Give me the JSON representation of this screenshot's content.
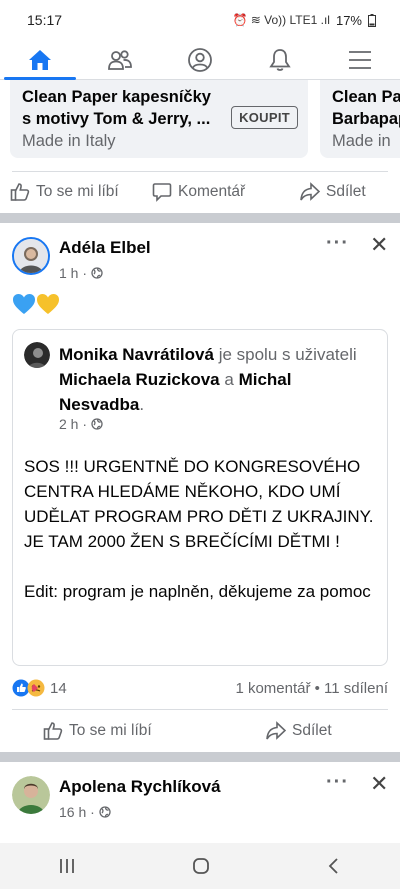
{
  "status_bar": {
    "time": "15:17",
    "icons": "⏰ ≋ Vo)) LTE1 .ıl",
    "battery": "17%"
  },
  "nav": {
    "items": [
      {
        "name": "home",
        "icon": "home-icon",
        "active": true
      },
      {
        "name": "friends",
        "icon": "friends-icon"
      },
      {
        "name": "profile",
        "icon": "profile-icon"
      },
      {
        "name": "notifications",
        "icon": "bell-icon"
      },
      {
        "name": "menu",
        "icon": "menu-icon"
      }
    ]
  },
  "carousel": {
    "cards": [
      {
        "title_line1": "Clean Paper kapesníčky",
        "title_line2": "s motivy Tom & Jerry, ...",
        "origin": "Made in Italy",
        "button": "KOUPIT"
      },
      {
        "title_line1": "Clean Pa",
        "title_line2": "Barbapap",
        "origin": "Made in"
      }
    ]
  },
  "actions_top": {
    "like": "To se mi líbí",
    "comment": "Komentář",
    "share": "Sdílet"
  },
  "post1": {
    "author": "Adéla Elbel",
    "time": "1 h ·",
    "emojis": "💙💛",
    "shared": {
      "author": "Monika Navrátilová",
      "with_text": "je spolu s uživateli",
      "tagged1": "Michaela Ruzickova",
      "and_text": "a",
      "tagged2": "Michal Nesvadba",
      "period": ".",
      "time": "2 h ·",
      "body1": "SOS !!! URGENTNĚ DO KONGRESOVÉHO CENTRA HLEDÁME NĚKOHO, KDO UMÍ UDĚLAT PROGRAM PRO DĚTI Z UKRAJINY. JE TAM 2000 ŽEN S BREČÍCÍMI DĚTMI !",
      "body2": "Edit: program je naplněn, děkujeme za pomoc"
    },
    "reaction_count": "14",
    "stats": "1 komentář • 11 sdílení",
    "like": "To se mi líbí",
    "share": "Sdílet"
  },
  "post2": {
    "author": "Apolena Rychlíková",
    "time": "16 h ·"
  },
  "colors": {
    "accent": "#1877f2",
    "muted": "#65676b",
    "divider": "#c9ccd1"
  }
}
